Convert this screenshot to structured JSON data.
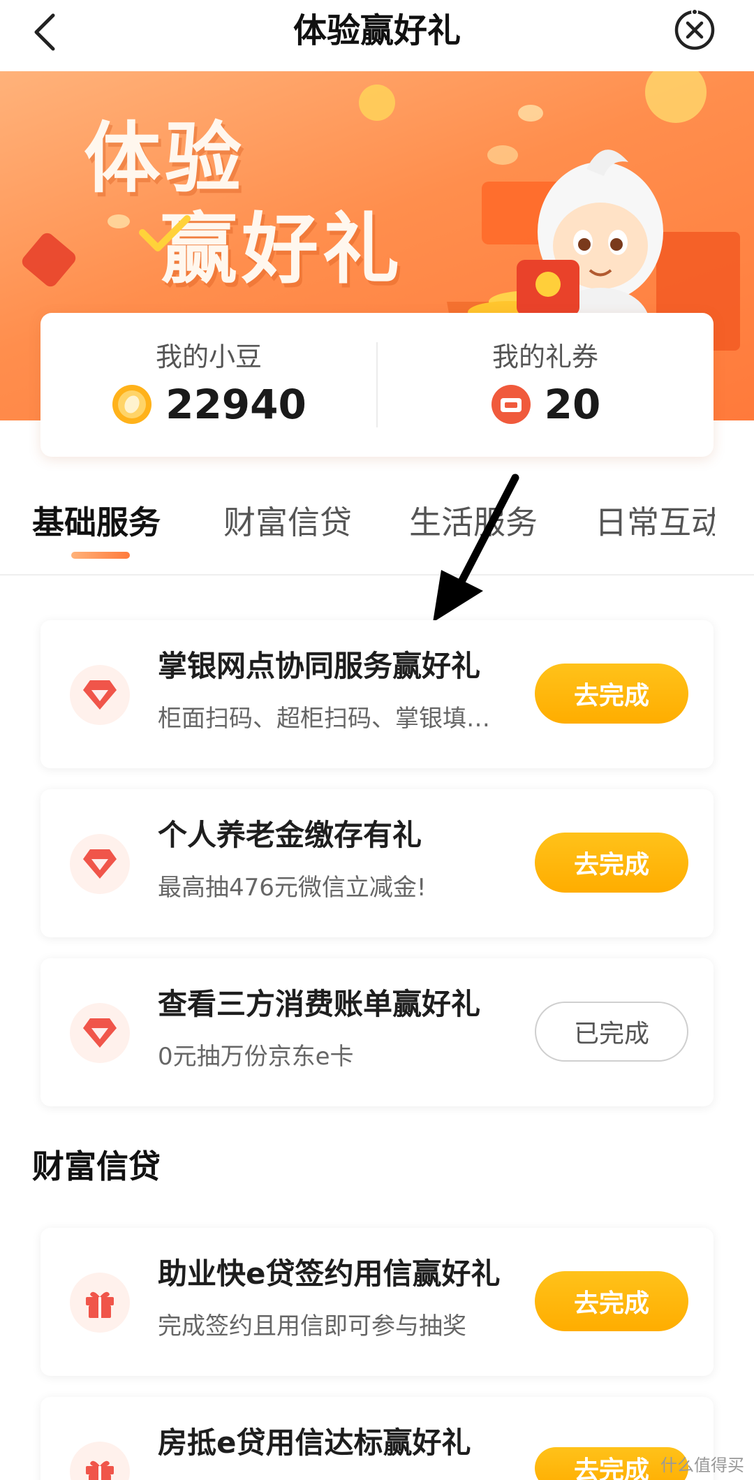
{
  "header": {
    "title": "体验赢好礼",
    "back_icon": "chevron-left-icon",
    "close_icon": "close-circle-icon"
  },
  "banner": {
    "title_line1": "体验",
    "title_line2": "赢好礼"
  },
  "stats": {
    "beans_label": "我的小豆",
    "beans_value": "22940",
    "coupons_label": "我的礼券",
    "coupons_value": "20"
  },
  "tabs": [
    {
      "label": "基础服务"
    },
    {
      "label": "财富信贷"
    },
    {
      "label": "生活服务"
    },
    {
      "label": "日常互动"
    }
  ],
  "tasks": [
    {
      "title": "掌银网点协同服务赢好礼",
      "subtitle": "柜面扫码、超柜扫码、掌银填…",
      "button": "去完成",
      "icon": "diamond-icon"
    },
    {
      "title": "个人养老金缴存有礼",
      "subtitle": "最高抽476元微信立减金!",
      "button": "去完成",
      "icon": "diamond-icon"
    },
    {
      "title": "查看三方消费账单赢好礼",
      "subtitle": "0元抽万份京东e卡",
      "button": "已完成",
      "icon": "diamond-icon"
    }
  ],
  "wealth_section": {
    "title": "财富信贷",
    "tasks": [
      {
        "title": "助业快e贷签约用信赢好礼",
        "subtitle": "完成签约且用信即可参与抽奖",
        "button": "去完成",
        "icon": "gift-icon"
      },
      {
        "title": "房抵e贷用信达标赢好礼",
        "subtitle": "",
        "button": "去完成",
        "icon": "gift-icon"
      }
    ]
  },
  "watermark": "什么值得买",
  "colors": {
    "accent_orange": "#ff7a3b",
    "button_yellow": "#ffad00",
    "icon_red": "#f0554a"
  }
}
